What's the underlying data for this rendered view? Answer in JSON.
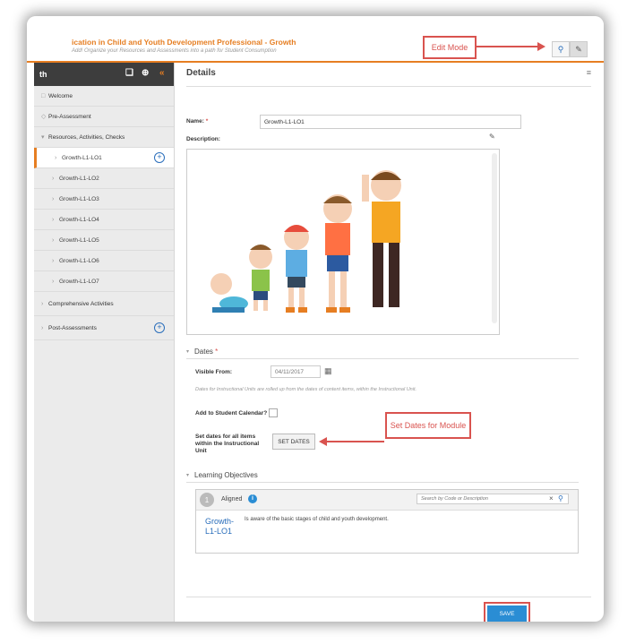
{
  "header": {
    "title": "ication in Child and Youth Development Professional - Growth",
    "subtitle": "Add! Organize your Resources and Assessments into a path for Student Consumption"
  },
  "callouts": {
    "edit_mode": "Edit Mode",
    "set_dates_module": "Set Dates for Module"
  },
  "sidebar": {
    "title": "th",
    "items": [
      {
        "label": "Welcome"
      },
      {
        "label": "Pre-Assessment"
      },
      {
        "label": "Resources, Activities, Checks"
      },
      {
        "label": "Growth-L1-LO1"
      },
      {
        "label": "Growth-L1-LO2"
      },
      {
        "label": "Growth-L1-LO3"
      },
      {
        "label": "Growth-L1-LO4"
      },
      {
        "label": "Growth-L1-LO5"
      },
      {
        "label": "Growth-L1-LO6"
      },
      {
        "label": "Growth-L1-LO7"
      },
      {
        "label": "Comprehensive Activities"
      },
      {
        "label": "Post-Assessments"
      }
    ]
  },
  "main": {
    "title": "Details",
    "name_label": "Name:",
    "name_value": "Growth-L1-LO1",
    "description_label": "Description:",
    "dates_section": "Dates",
    "visible_from_label": "Visible From:",
    "visible_from_value": "04/11/2017",
    "dates_note": "Dates for Instructional Units are rolled up from the dates of content items, within the Instructional Unit.",
    "add_calendar_label": "Add to Student Calendar?",
    "set_dates_label": "Set dates for all items within the Instructional Unit",
    "set_dates_button": "SET DATES",
    "lo_section": "Learning Objectives",
    "lo_count": "1",
    "lo_aligned": "Aligned",
    "lo_search_placeholder": "Search by Code or Description",
    "lo_code": "Growth-L1-LO1",
    "lo_desc": "Is aware of the basic stages of child and youth development.",
    "save_button": "SAVE"
  },
  "colors": {
    "accent_orange": "#e67e22",
    "callout_red": "#d9534f",
    "link_blue": "#2a6ebb",
    "save_blue": "#2a8dd4"
  }
}
